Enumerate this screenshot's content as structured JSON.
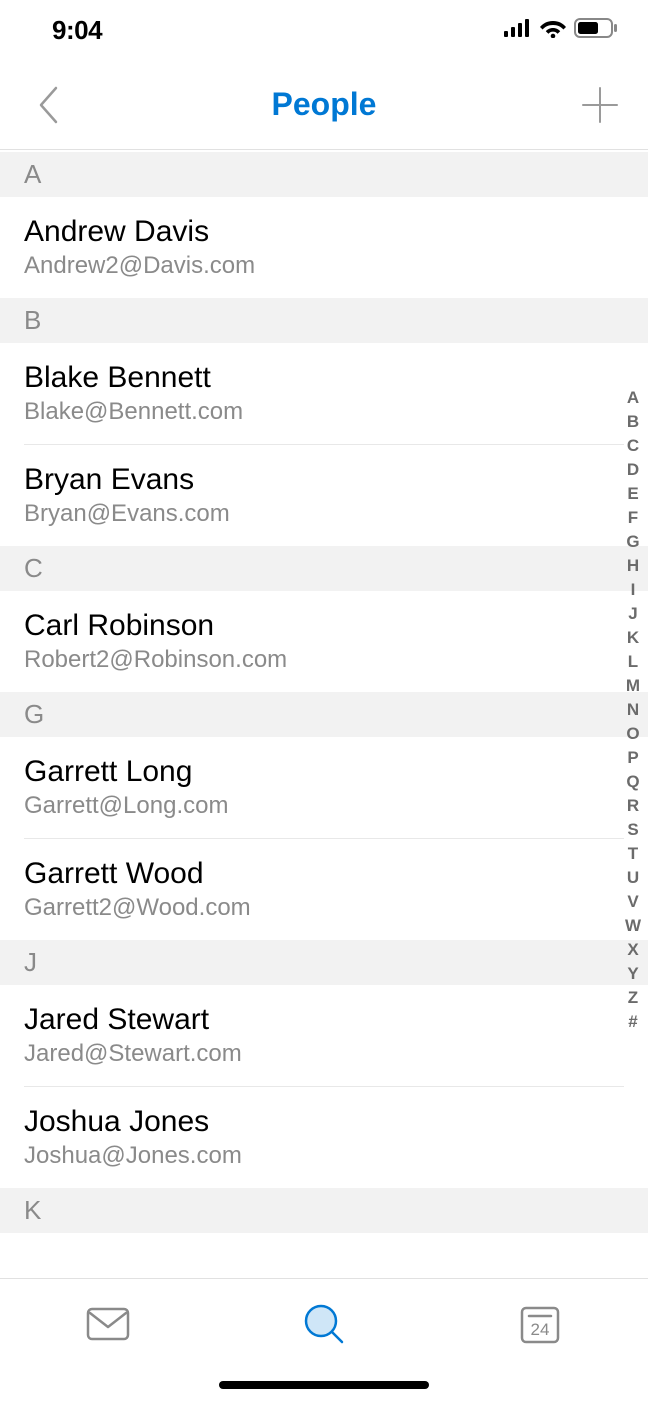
{
  "status": {
    "time": "9:04"
  },
  "header": {
    "title": "People"
  },
  "calendar": {
    "day": "24"
  },
  "sections": [
    {
      "letter": "A",
      "contacts": [
        {
          "name": "Andrew Davis",
          "email": "Andrew2@Davis.com"
        }
      ]
    },
    {
      "letter": "B",
      "contacts": [
        {
          "name": "Blake Bennett",
          "email": "Blake@Bennett.com"
        },
        {
          "name": "Bryan Evans",
          "email": "Bryan@Evans.com"
        }
      ]
    },
    {
      "letter": "C",
      "contacts": [
        {
          "name": "Carl Robinson",
          "email": "Robert2@Robinson.com"
        }
      ]
    },
    {
      "letter": "G",
      "contacts": [
        {
          "name": "Garrett Long",
          "email": "Garrett@Long.com"
        },
        {
          "name": "Garrett Wood",
          "email": "Garrett2@Wood.com"
        }
      ]
    },
    {
      "letter": "J",
      "contacts": [
        {
          "name": "Jared Stewart",
          "email": "Jared@Stewart.com"
        },
        {
          "name": "Joshua Jones",
          "email": "Joshua@Jones.com"
        }
      ]
    },
    {
      "letter": "K",
      "contacts": []
    }
  ],
  "alpha_index": [
    "A",
    "B",
    "C",
    "D",
    "E",
    "F",
    "G",
    "H",
    "I",
    "J",
    "K",
    "L",
    "M",
    "N",
    "O",
    "P",
    "Q",
    "R",
    "S",
    "T",
    "U",
    "V",
    "W",
    "X",
    "Y",
    "Z",
    "#"
  ]
}
